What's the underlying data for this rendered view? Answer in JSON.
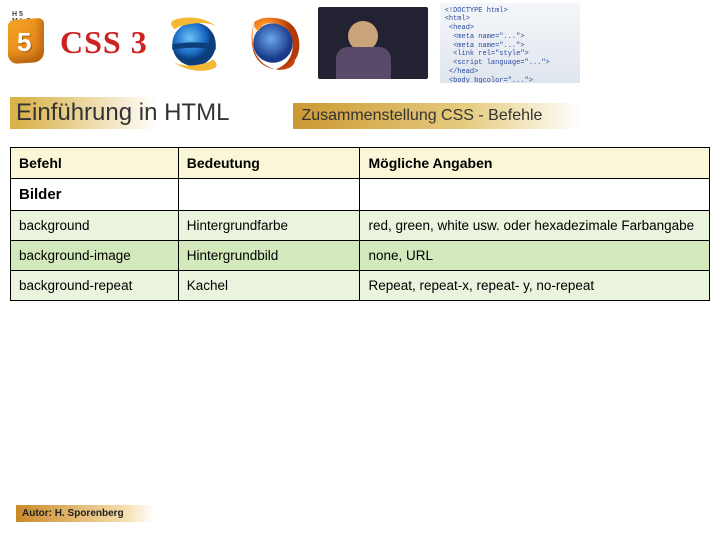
{
  "header": {
    "brand_text": "CSS 3",
    "html5_tag": "H5 MLS",
    "code_snippet": "<!DOCTYPE html>\n<html>\n <head>\n  <meta name=\"...\">\n  <meta name=\"...\">\n  <link rel=\"style\">\n  <script language=\"...\">\n </head>\n <body bgcolor=\"...\">"
  },
  "titles": {
    "main": "Einführung in HTML",
    "sub": "Zusammenstellung CSS - Befehle"
  },
  "table": {
    "headers": {
      "c1": "Befehl",
      "c2": "Bedeutung",
      "c3": "Mögliche Angaben"
    },
    "section": "Bilder",
    "rows": [
      {
        "cmd": "background",
        "meaning": "Hintergrundfarbe",
        "values": "red, green, white usw. oder hexadezimale Farbangabe"
      },
      {
        "cmd": "background-image",
        "meaning": "Hintergrundbild",
        "values": "none, URL"
      },
      {
        "cmd": "background-repeat",
        "meaning": "Kachel",
        "values": "Repeat, repeat-x, repeat- y, no-repeat"
      }
    ]
  },
  "footer": {
    "author": "Autor: H. Sporenberg"
  }
}
